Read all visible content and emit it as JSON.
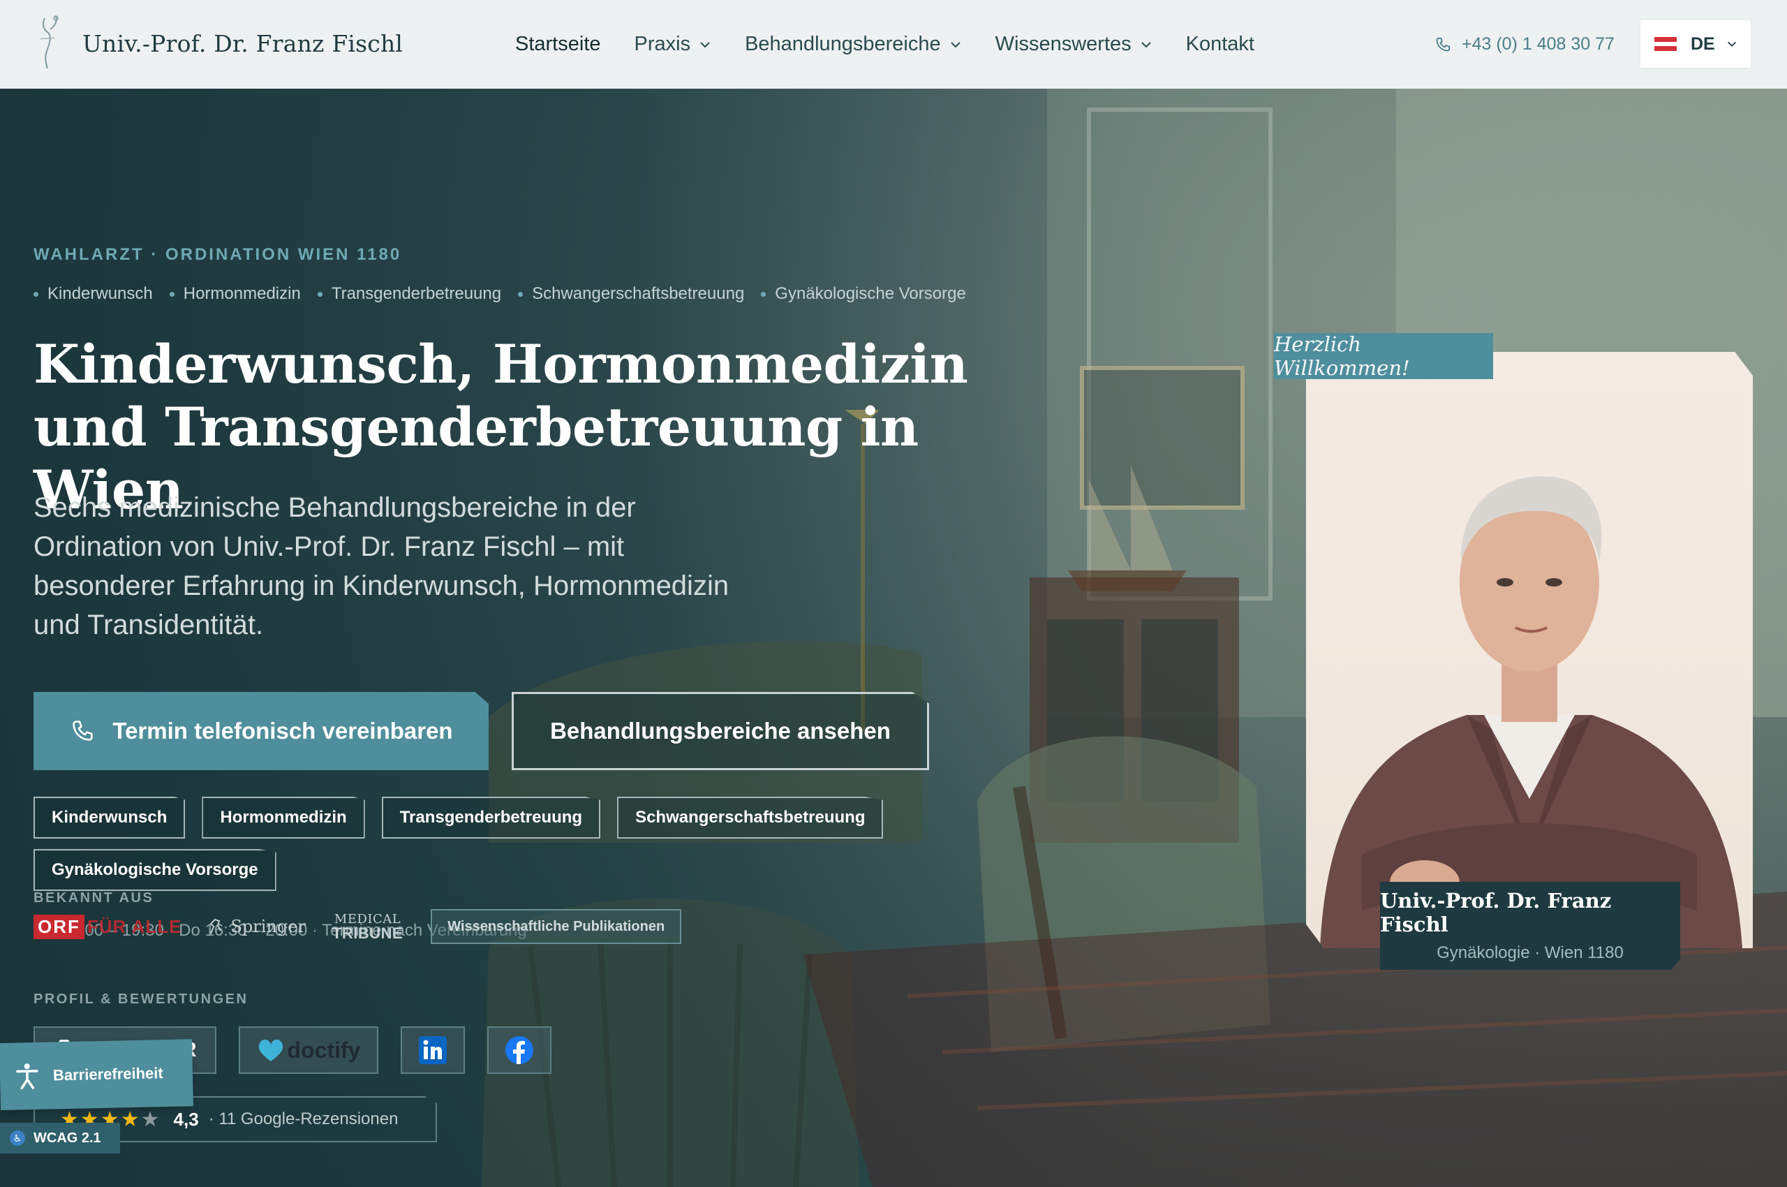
{
  "brand": {
    "name": "Univ.-Prof. Dr. Franz Fischl"
  },
  "nav": {
    "items": [
      {
        "label": "Startseite",
        "dropdown": false
      },
      {
        "label": "Praxis",
        "dropdown": true
      },
      {
        "label": "Behandlungsbereiche",
        "dropdown": true
      },
      {
        "label": "Wissenswertes",
        "dropdown": true
      },
      {
        "label": "Kontakt",
        "dropdown": false
      }
    ],
    "phone": "+43 (0) 1 408 30 77",
    "language": "DE"
  },
  "hero": {
    "eyebrow": "WAHLARZT · ORDINATION WIEN 1180",
    "topics": [
      "Kinderwunsch",
      "Hormonmedizin",
      "Transgenderbetreuung",
      "Schwangerschaftsbetreuung",
      "Gynäkologische Vorsorge"
    ],
    "title_line1": "Kinderwunsch, Hormonmedizin",
    "title_line2": "und Transgenderbetreuung in Wien",
    "lead": "Sechs medizinische Behandlungsbereiche in der Ordination von Univ.-Prof. Dr. Franz Fischl – mit besonderer Erfahrung in Kinderwunsch, Hormonmedizin und Transidentität.",
    "cta_primary": "Termin telefonisch vereinbaren",
    "cta_secondary": "Behandlungsbereiche ansehen",
    "chips": [
      "Kinderwunsch",
      "Hormonmedizin",
      "Transgenderbetreuung",
      "Schwangerschaftsbetreuung",
      "Gynäkologische Vorsorge"
    ],
    "hours": "Mo 16:00 – 19:30 · Do 16:30 – 20:00 · Termine nach Vereinbarung"
  },
  "press": {
    "label": "BEKANNT AUS",
    "orf_box": "ORF",
    "orf_text": "FÜR ALLE",
    "springer": "Springer",
    "tribune_top": "MEDICAL",
    "tribune_bottom": "TRIBUNE",
    "publications_button": "Wissenschaftliche Publikationen"
  },
  "profiles": {
    "label": "PROFIL & BEWERTUNGEN",
    "doctify": "doctify",
    "drs_visible": "R",
    "rating_score": "4,3",
    "rating_count": "· 11 Google-Rezensionen",
    "stars_filled": 4,
    "stars_total": 5
  },
  "accessibility": {
    "button": "Barrierefreiheit",
    "badge": "WCAG 2.1"
  },
  "portrait": {
    "welcome": "Herzlich Willkommen!",
    "name": "Univ.-Prof. Dr. Franz Fischl",
    "subtitle": "Gynäkologie · Wien 1180"
  },
  "colors": {
    "accent": "#4f8e9c",
    "dark": "#1e3a40",
    "header_bg": "#eef1f1",
    "star": "#f2b817",
    "orf_red": "#c8282e"
  }
}
